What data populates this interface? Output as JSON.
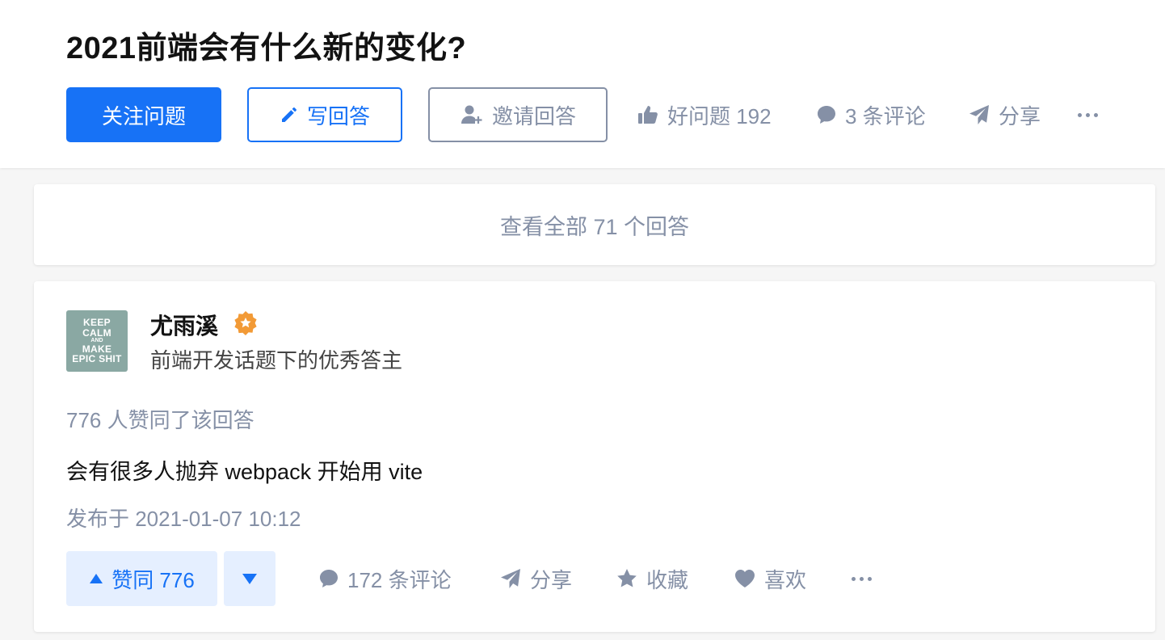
{
  "question": {
    "title": "2021前端会有什么新的变化?",
    "follow_label": "关注问题",
    "write_label": "写回答",
    "invite_label": "邀请回答",
    "good_question_label": "好问题 192",
    "comments_label": "3 条评论",
    "share_label": "分享"
  },
  "view_all": {
    "label": "查看全部 71 个回答"
  },
  "answer": {
    "author": {
      "name": "尤雨溪",
      "headline": "前端开发话题下的优秀答主",
      "avatar_lines": [
        "KEEP",
        "CALM",
        "AND",
        "MAKE",
        "EPIC SHIT"
      ]
    },
    "vote_summary": "776 人赞同了该回答",
    "content": "会有很多人抛弃 webpack 开始用 vite",
    "publish_time": "发布于 2021-01-07 10:12",
    "vote_up_label": "赞同 776",
    "comments_label": "172 条评论",
    "share_label": "分享",
    "collect_label": "收藏",
    "like_label": "喜欢"
  },
  "colors": {
    "brand": "#1772f6",
    "muted": "#8590a6",
    "vote_bg": "#e5efff",
    "badge": "#f29a36"
  },
  "icons": [
    "pencil-icon",
    "invite-user-icon",
    "thumbs-up-icon",
    "comment-icon",
    "share-icon",
    "more-icon",
    "triangle-up-icon",
    "triangle-down-icon",
    "star-icon",
    "heart-icon",
    "badge-icon"
  ]
}
